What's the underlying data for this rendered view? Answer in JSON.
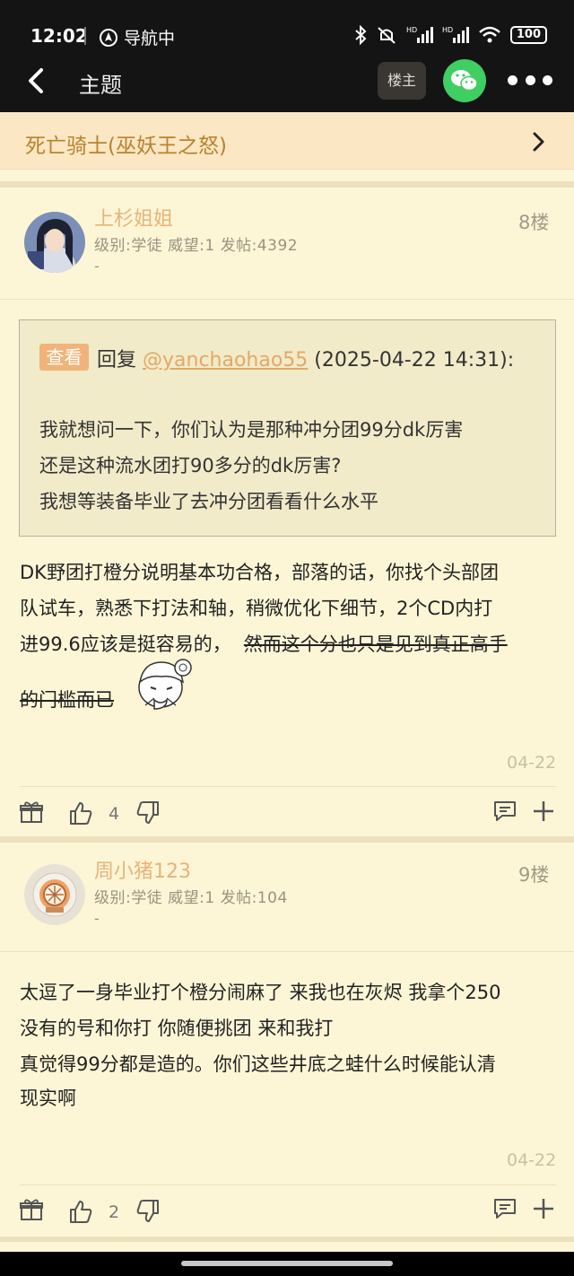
{
  "status_bar": {
    "time": "12:02",
    "navigation": "导航中",
    "battery": "100"
  },
  "navbar": {
    "title": "主题",
    "louzhu_label": "楼主"
  },
  "forum": {
    "name": "死亡骑士(巫妖王之怒)"
  },
  "posts": [
    {
      "username": "上杉姐姐",
      "meta": "级别:学徒 威望:1 发帖:4392",
      "sub": "-",
      "floor": "8楼",
      "quote": {
        "badge": "查看",
        "prefix": "回复 ",
        "user": "@yanchaohao55",
        "time": " (2025-04-22 14:31):",
        "lines": [
          "我就想问一下，你们认为是那种冲分团99分dk厉害",
          "还是这种流水团打90多分的dk厉害?",
          "我想等装备毕业了去冲分团看看什么水平"
        ]
      },
      "body_lines": [
        "DK野团打橙分说明基本功合格，部落的话，你找个头部团",
        "队试车，熟悉下打法和轴，稍微优化下细节，2个CD内打",
        "进99.6应该是挺容易的，"
      ],
      "strike_1": "然而这个分也只是见到真正高手",
      "strike_2": "的门槛而已",
      "date": "04-22",
      "likes": "4"
    },
    {
      "username": "周小猪123",
      "meta": "级别:学徒 威望:1 发帖:104",
      "sub": "-",
      "floor": "9楼",
      "body_lines": [
        "太逗了一身毕业打个橙分闹麻了 来我也在灰烬 我拿个250",
        "没有的号和你打 你随便挑团 来和我打",
        "真觉得99分都是造的。你们这些井底之蛙什么时候能认清",
        "现实啊"
      ],
      "date": "04-22",
      "likes": "2"
    }
  ]
}
